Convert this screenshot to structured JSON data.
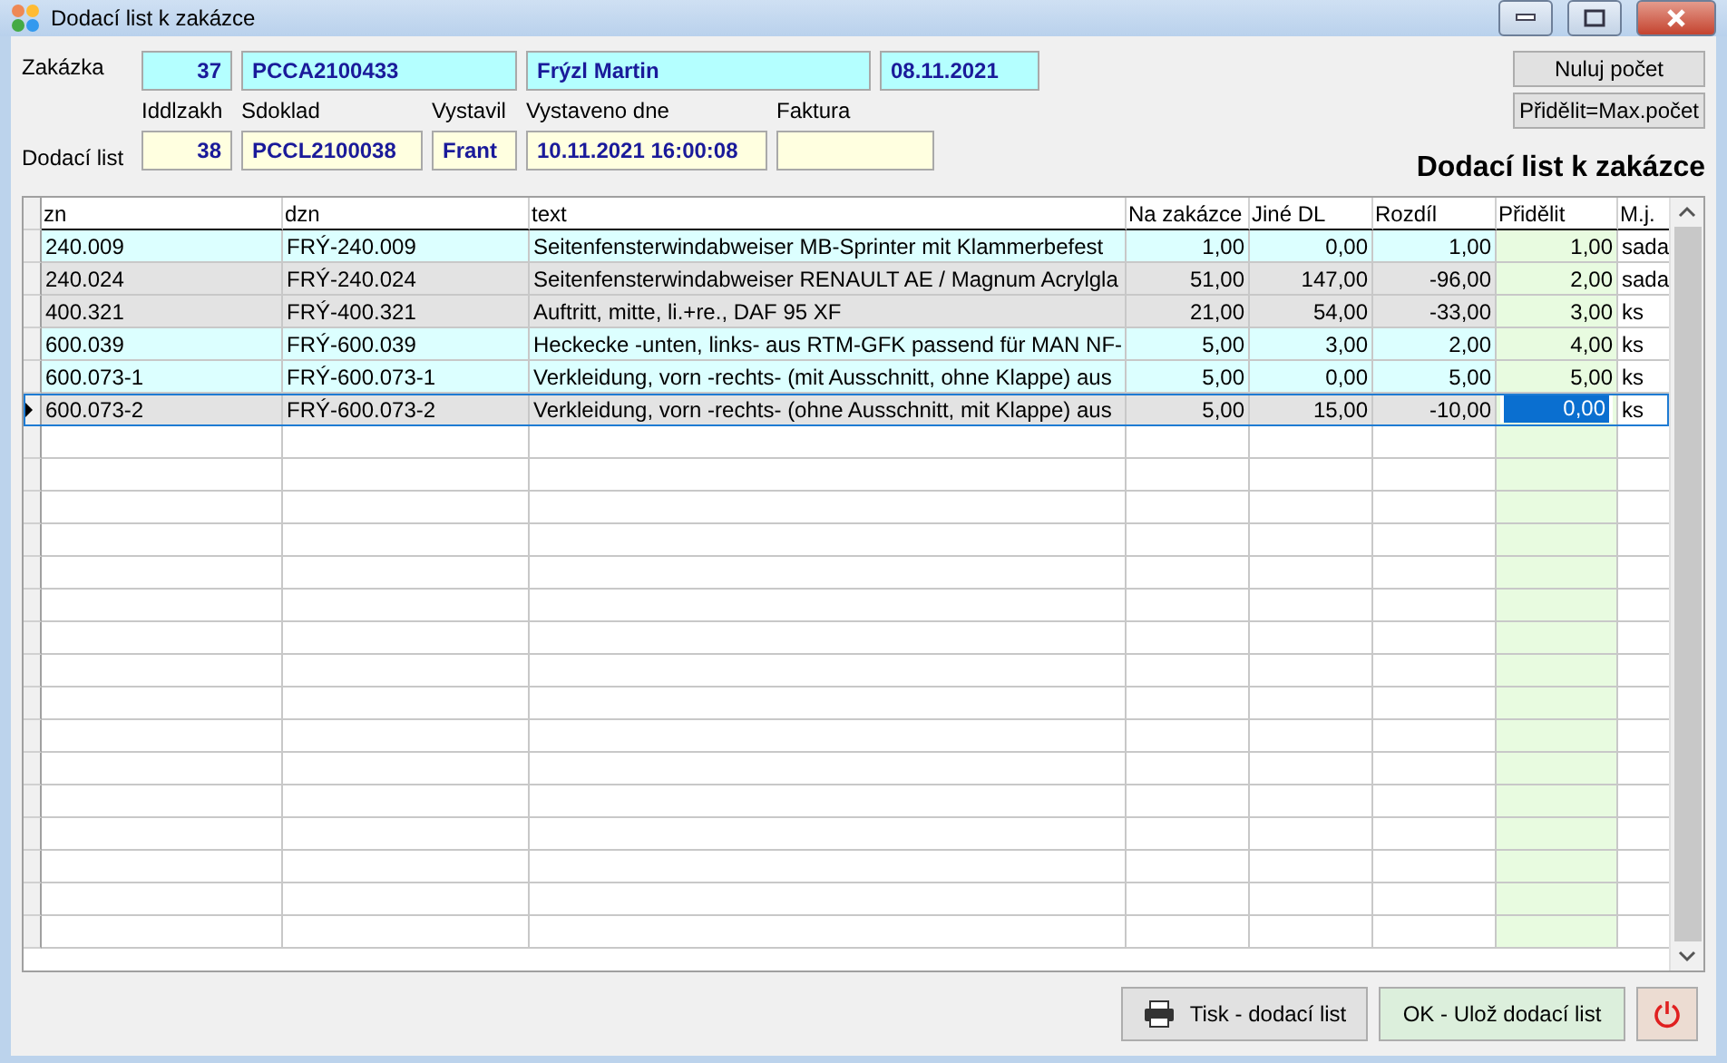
{
  "window": {
    "title": "Dodací list k zakázce"
  },
  "order": {
    "label": "Zakázka",
    "fields": [
      {
        "value": "37"
      },
      {
        "value": "PCCA2100433"
      },
      {
        "value": "Frýzl Martin"
      },
      {
        "value": "08.11.2021"
      }
    ]
  },
  "delivery": {
    "label": "Dodací list",
    "fields": [
      {
        "caption": "Iddlzakh",
        "value": "38"
      },
      {
        "caption": "Sdoklad",
        "value": "PCCL2100038"
      },
      {
        "caption": "Vystavil",
        "value": "Frant"
      },
      {
        "caption": "Vystaveno dne",
        "value": "10.11.2021 16:00:08"
      },
      {
        "caption": "Faktura"
      }
    ]
  },
  "side_buttons": [
    "Nuluj počet",
    "Přidělit=Max.počet"
  ],
  "heading": "Dodací list k zakázce",
  "table": {
    "columns": [
      "zn",
      "dzn",
      "text",
      "Na zakázce",
      "Jiné DL",
      "Rozdíl",
      "Přidělit",
      "M.j."
    ],
    "rows": [
      {
        "cells": [
          "240.009",
          "FRÝ-240.009",
          "Seitenfensterwindabweiser MB-Sprinter mit Klammerbefest",
          "1,00",
          "0,00",
          "1,00",
          "1,00",
          "sada"
        ],
        "shortage": false,
        "selected": false
      },
      {
        "cells": [
          "240.024",
          "FRÝ-240.024",
          "Seitenfensterwindabweiser RENAULT AE / Magnum Acrylgla",
          "51,00",
          "147,00",
          "-96,00",
          "2,00",
          "sada"
        ],
        "shortage": true,
        "selected": false
      },
      {
        "cells": [
          "400.321",
          "FRÝ-400.321",
          "Auftritt, mitte, li.+re., DAF 95 XF",
          "21,00",
          "54,00",
          "-33,00",
          "3,00",
          "ks"
        ],
        "shortage": true,
        "selected": false
      },
      {
        "cells": [
          "600.039",
          "FRÝ-600.039",
          "Heckecke -unten, links- aus RTM-GFK passend für MAN NF-",
          "5,00",
          "3,00",
          "2,00",
          "4,00",
          "ks"
        ],
        "shortage": false,
        "selected": false
      },
      {
        "cells": [
          "600.073-1",
          "FRÝ-600.073-1",
          "Verkleidung, vorn -rechts- (mit Ausschnitt, ohne Klappe) aus",
          "5,00",
          "0,00",
          "5,00",
          "5,00",
          "ks"
        ],
        "shortage": false,
        "selected": false
      },
      {
        "cells": [
          "600.073-2",
          "FRÝ-600.073-2",
          "Verkleidung, vorn -rechts- (ohne Ausschnitt, mit Klappe) aus",
          "5,00",
          "15,00",
          "-10,00",
          "0,00",
          "ks"
        ],
        "shortage": true,
        "selected": true
      }
    ]
  },
  "footer_buttons": [
    {
      "kind": "print",
      "label": "Tisk - dodací list"
    },
    {
      "kind": "save",
      "label": "OK - Ulož dodací list"
    },
    {
      "kind": "power"
    }
  ]
}
